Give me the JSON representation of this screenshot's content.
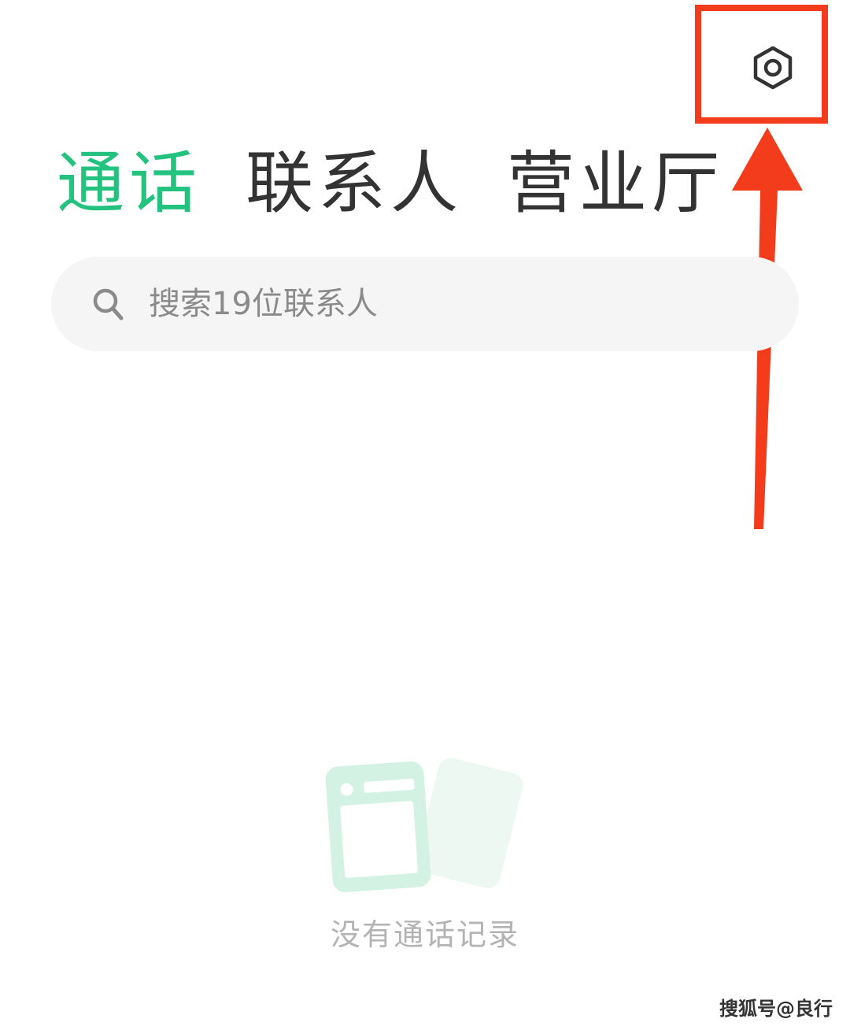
{
  "header": {
    "settings_icon": "gear-icon"
  },
  "tabs": [
    {
      "label": "通话",
      "active": true
    },
    {
      "label": "联系人",
      "active": false
    },
    {
      "label": "营业厅",
      "active": false
    }
  ],
  "search": {
    "placeholder": "搜索19位联系人",
    "icon": "search-icon"
  },
  "empty_state": {
    "message": "没有通话记录",
    "illustration": "empty-call-log-illustration"
  },
  "watermark": "搜狐号@良行",
  "colors": {
    "accent": "#23c27e",
    "annotation": "#f23c1c",
    "text": "#333333",
    "muted": "#b3b3b3"
  }
}
